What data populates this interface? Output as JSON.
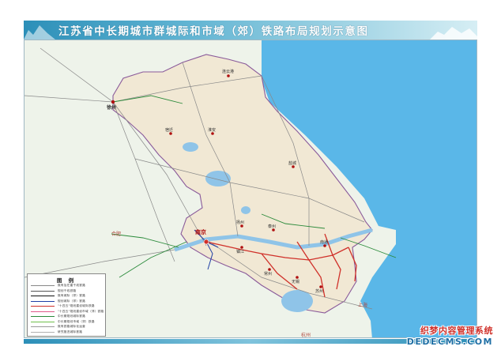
{
  "title": "江苏省中长期城市群城际和市域（郊）铁路布局规划示意图",
  "colors": {
    "sea": "#5ab7e8",
    "province": "#f1e8d4",
    "outside": "#eef3ea",
    "border": "#8a5a9a",
    "lake": "#8fc4e8",
    "red_line": "#d0312a",
    "green_line": "#2a8a3a",
    "blue_line": "#1f3fa5"
  },
  "cities": {
    "xuzhou": "徐州",
    "suqian": "宿迁",
    "huaian": "淮安",
    "lianyungang": "连云港",
    "yancheng": "盐城",
    "yangzhou": "扬州",
    "taizhou": "泰州",
    "nantong": "南通",
    "nanjing": "南京",
    "zhenjiang": "镇江",
    "changzhou": "常州",
    "wuxi": "无锡",
    "suzhou": "苏州",
    "hefei": "合肥",
    "shanghai": "上海",
    "hangzhou": "杭州"
  },
  "legend": {
    "title": "图 例",
    "items": [
      {
        "text": "既有及在建干线铁路",
        "color": "#888888"
      },
      {
        "text": "规划干线铁路",
        "color": "#555555"
      },
      {
        "text": "既有城际（郊）铁路",
        "color": "#111111"
      },
      {
        "text": "规划城际（郊）铁路",
        "color": "#1f3fa5"
      },
      {
        "text": "\"十四五\"规划建设城际铁路",
        "color": "#d0312a"
      },
      {
        "text": "\"十四五\"规划建设市域（郊）铁路",
        "color": "#e05a8a"
      },
      {
        "text": "中长期规划城际铁路",
        "color": "#2a8a3a"
      },
      {
        "text": "中长期规划市域（郊）铁路",
        "color": "#6fbf4a"
      },
      {
        "text": "既有铁路城际化运营",
        "color": "#9a9a9a"
      },
      {
        "text": "研究推进城际铁路",
        "color": "#b0b0b0"
      }
    ]
  },
  "watermark": {
    "line1": "织梦内容管理系统",
    "line2": "DEDECMS.COM"
  }
}
